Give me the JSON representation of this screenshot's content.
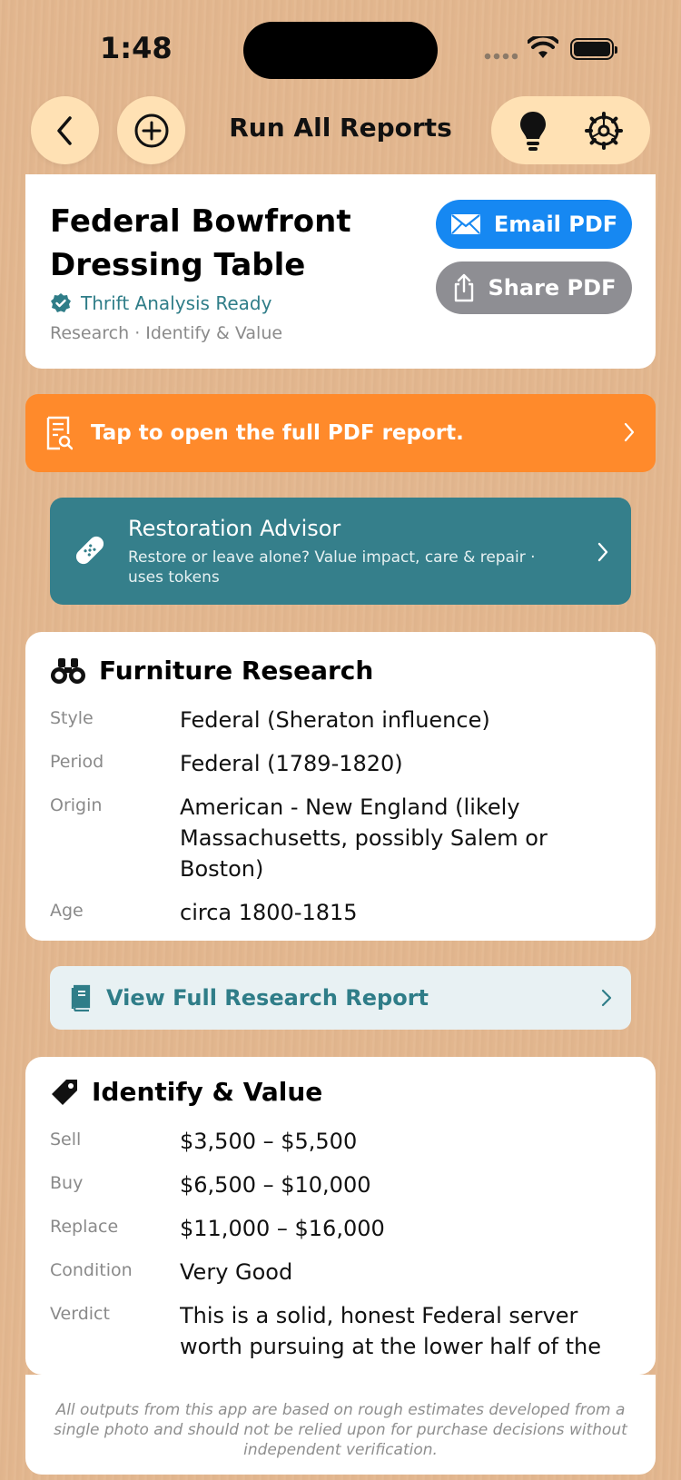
{
  "status_bar": {
    "time": "1:48"
  },
  "nav": {
    "title": "Run All Reports"
  },
  "item": {
    "title": "Federal Bowfront Dressing Table",
    "status": "Thrift Analysis Ready",
    "subtitle": "Research · Identify & Value"
  },
  "actions": {
    "email_label": "Email PDF",
    "share_label": "Share PDF"
  },
  "banner": {
    "label": "Tap to open the full PDF report."
  },
  "restoration": {
    "title": "Restoration Advisor",
    "description": "Restore or leave alone? Value impact, care & repair · uses tokens"
  },
  "research": {
    "heading": "Furniture Research",
    "rows": [
      {
        "key": "Style",
        "value": "Federal (Sheraton influence)"
      },
      {
        "key": "Period",
        "value": "Federal (1789-1820)"
      },
      {
        "key": "Origin",
        "value": "American - New England (likely Massachusetts, possibly Salem or Boston)"
      },
      {
        "key": "Age",
        "value": "circa 1800-1815"
      }
    ],
    "full_report_label": "View Full Research Report"
  },
  "value": {
    "heading": "Identify & Value",
    "rows": [
      {
        "key": "Sell",
        "value": "$3,500 – $5,500"
      },
      {
        "key": "Buy",
        "value": "$6,500 – $10,000"
      },
      {
        "key": "Replace",
        "value": "$11,000 – $16,000"
      },
      {
        "key": "Condition",
        "value": "Very Good"
      },
      {
        "key": "Verdict",
        "value": "This is a solid, honest Federal server worth pursuing at the lower half of the e"
      }
    ]
  },
  "disclaimer": "All outputs from this app are based on rough estimates developed from a single photo and should not be relied upon for purchase decisions without independent verification.",
  "colors": {
    "background": "#e3b78f",
    "nav_button": "#ffe1b4",
    "email_button": "#1688f2",
    "share_button": "#8e8e93",
    "banner": "#ff8a2b",
    "restoration": "#357f8b",
    "accent_teal": "#2f7d88"
  },
  "icons": [
    "back-chevron-icon",
    "add-circle-icon",
    "lightbulb-icon",
    "gear-icon",
    "verified-badge-icon",
    "envelope-icon",
    "share-icon",
    "document-search-icon",
    "bandage-icon",
    "binoculars-icon",
    "book-icon",
    "tag-icon",
    "chevron-right-icon"
  ]
}
